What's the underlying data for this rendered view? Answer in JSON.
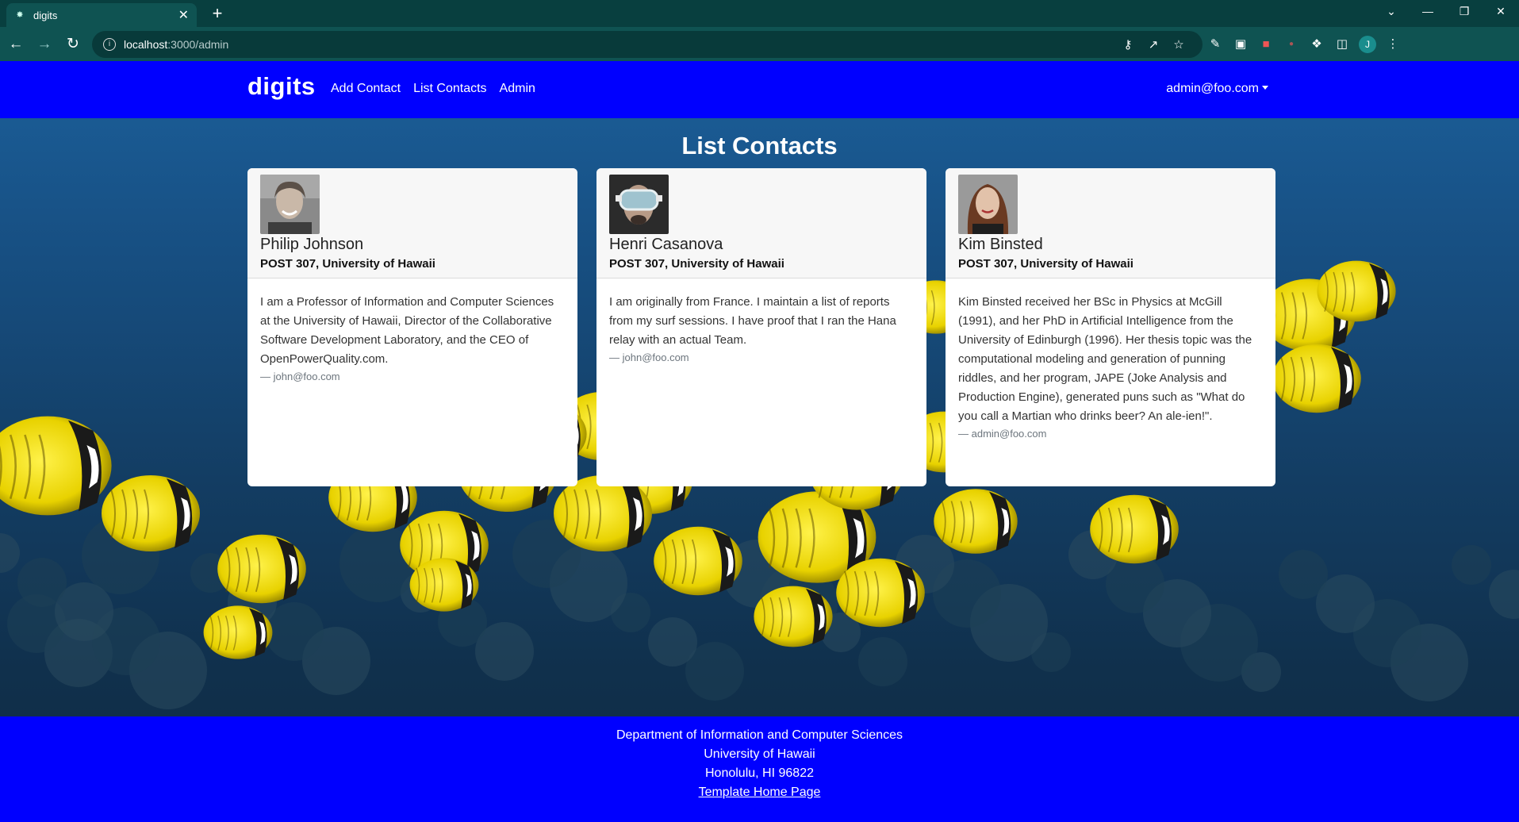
{
  "browser": {
    "tab_title": "digits",
    "url_host": "localhost",
    "url_path": ":3000/admin",
    "profile_initial": "J"
  },
  "navbar": {
    "brand": "digits",
    "links": [
      "Add Contact",
      "List Contacts",
      "Admin"
    ],
    "user": "admin@foo.com"
  },
  "page": {
    "title": "List Contacts"
  },
  "contacts": [
    {
      "name": "Philip Johnson",
      "address": "POST 307, University of Hawaii",
      "description": "I am a Professor of Information and Computer Sciences at the University of Hawaii, Director of the Collaborative Software Development Laboratory, and the CEO of OpenPowerQuality.com.",
      "owner": "— john@foo.com"
    },
    {
      "name": "Henri Casanova",
      "address": "POST 307, University of Hawaii",
      "description": "I am originally from France. I maintain a list of reports from my surf sessions. I have proof that I ran the Hana relay with an actual Team.",
      "owner": "— john@foo.com"
    },
    {
      "name": "Kim Binsted",
      "address": "POST 307, University of Hawaii",
      "description": "Kim Binsted received her BSc in Physics at McGill (1991), and her PhD in Artificial Intelligence from the University of Edinburgh (1996). Her thesis topic was the computational modeling and generation of punning riddles, and her program, JAPE (Joke Analysis and Production Engine), generated puns such as \"What do you call a Martian who drinks beer? An ale-ien!\".",
      "owner": "— admin@foo.com"
    }
  ],
  "footer": {
    "line1": "Department of Information and Computer Sciences",
    "line2": "University of Hawaii",
    "line3": "Honolulu, HI 96822",
    "link": "Template Home Page"
  },
  "colors": {
    "navbar": "#0000ff",
    "footer": "#0000ff",
    "browser_frame": "#0f5352"
  }
}
